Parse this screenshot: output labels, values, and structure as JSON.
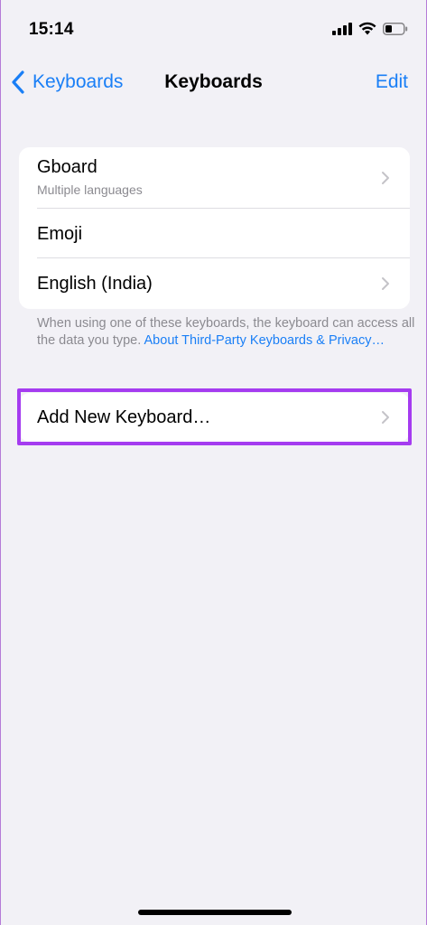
{
  "status_bar": {
    "time": "15:14"
  },
  "nav": {
    "back_label": "Keyboards",
    "title": "Keyboards",
    "edit_label": "Edit"
  },
  "keyboards": [
    {
      "title": "Gboard",
      "subtitle": "Multiple languages",
      "has_chevron": true
    },
    {
      "title": "Emoji",
      "has_chevron": false
    },
    {
      "title": "English (India)",
      "has_chevron": true
    }
  ],
  "footnote": {
    "text": "When using one of these keyboards, the keyboard can access all the data you type. ",
    "link": "About Third-Party Keyboards & Privacy…"
  },
  "add_keyboard": {
    "label": "Add New Keyboard…"
  },
  "colors": {
    "accent": "#1a7ff6",
    "highlight": "#a53cf0",
    "background": "#f2f1f6"
  }
}
